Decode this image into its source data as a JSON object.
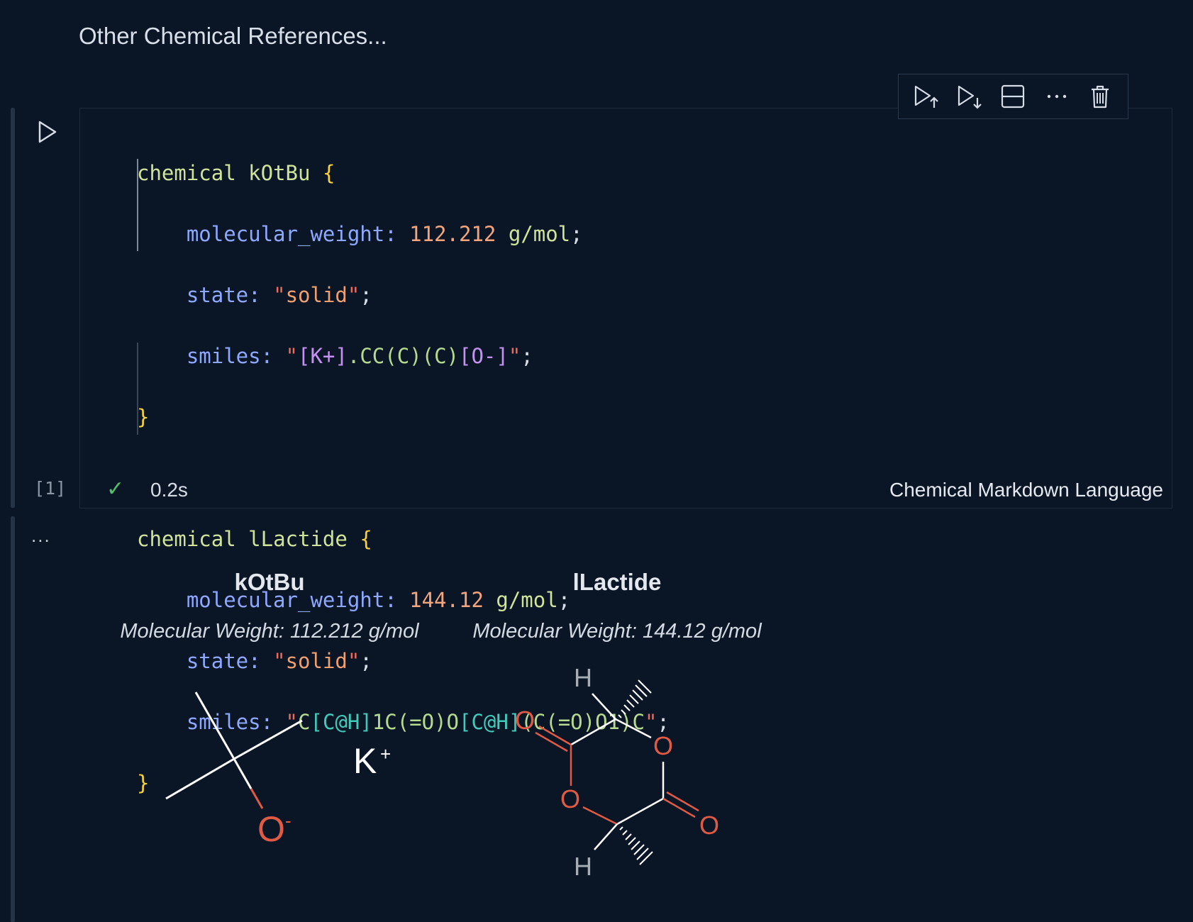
{
  "heading": "Other Chemical References...",
  "toolbar": {
    "icons": [
      "run-above-icon",
      "run-below-icon",
      "split-cell-icon",
      "more-icon",
      "delete-icon"
    ]
  },
  "code": {
    "chem1": {
      "keyword": "chemical",
      "name": "kOtBu",
      "mw_key": "molecular_weight",
      "mw_value": "112.212",
      "mw_unit": "g/mol",
      "state_key": "state",
      "state_value": "solid",
      "smiles_key": "smiles",
      "smiles_parts": [
        "[K+]",
        ".CC(C)(C)",
        "[O-]"
      ]
    },
    "chem2": {
      "keyword": "chemical",
      "name": "lLactide",
      "mw_key": "molecular_weight",
      "mw_value": "144.12",
      "mw_unit": "g/mol",
      "state_key": "state",
      "state_value": "solid",
      "smiles_key": "smiles",
      "smiles_parts": [
        "C",
        "[C@H]",
        "1C(=O)O",
        "[C@H]",
        "(C(=O)O1)C"
      ]
    }
  },
  "status": {
    "exec_count": "[1]",
    "time": "0.2s",
    "language": "Chemical Markdown Language"
  },
  "output": {
    "more": "...",
    "cards": [
      {
        "title": "kOtBu",
        "molecular_weight": "Molecular Weight: 112.212 g/mol",
        "atoms": {
          "oxygen": "O",
          "charge": "-",
          "potassium": "K",
          "k_charge": "+"
        }
      },
      {
        "title": "lLactide",
        "molecular_weight": "Molecular Weight: 144.12 g/mol",
        "atoms": {
          "o1": "O",
          "o2": "O",
          "o3": "O",
          "o4": "O",
          "h1": "H",
          "h2": "H"
        }
      }
    ]
  },
  "colors": {
    "background": "#0a1626",
    "oxygen": "#e05a44",
    "hydrogen": "#a7adb4",
    "bond": "#ffffff"
  }
}
